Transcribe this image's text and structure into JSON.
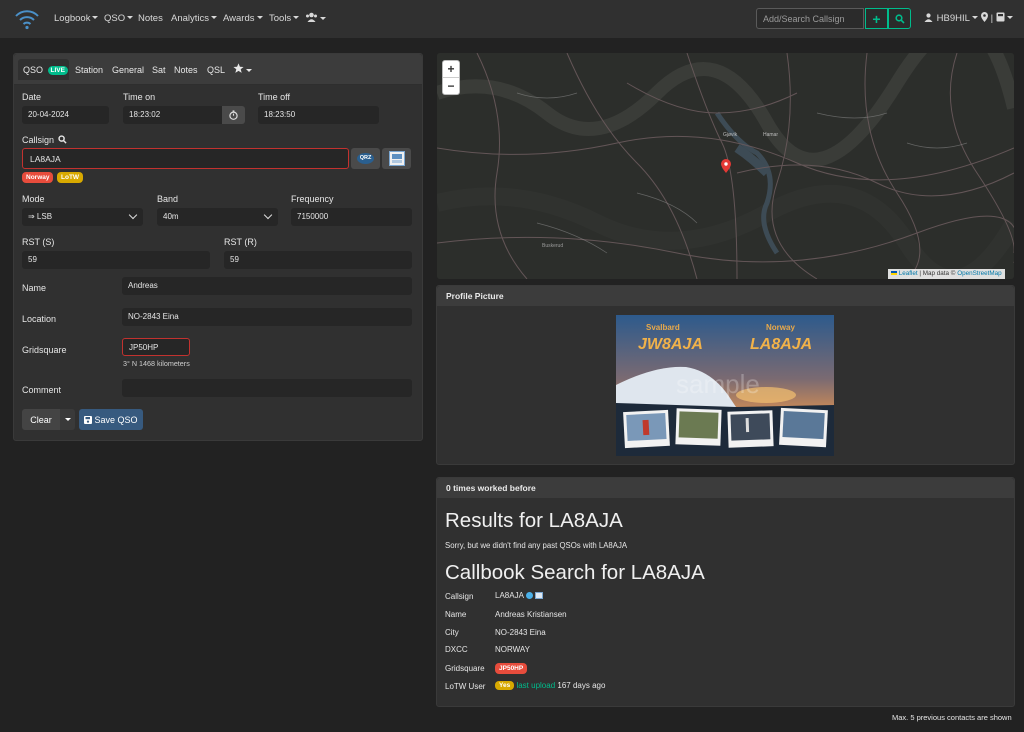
{
  "nav": {
    "items": [
      "Logbook",
      "QSO",
      "Notes",
      "Analytics",
      "Awards",
      "Tools"
    ],
    "search_placeholder": "Add/Search Callsign",
    "user": "HB9HIL"
  },
  "qso": {
    "tabs": {
      "qso": "QSO",
      "live": "LIVE",
      "station": "Station",
      "general": "General",
      "sat": "Sat",
      "notes": "Notes",
      "qsl": "QSL"
    },
    "date_label": "Date",
    "date": "20-04-2024",
    "time_on_label": "Time on",
    "time_on": "18:23:02",
    "time_off_label": "Time off",
    "time_off": "18:23:50",
    "callsign_label": "Callsign",
    "callsign": "LA8AJA",
    "badges": {
      "country": "Norway",
      "lotw": "LoTW"
    },
    "qrz_label": "QRZ",
    "mode_label": "Mode",
    "mode": "⇒ LSB",
    "band_label": "Band",
    "band": "40m",
    "frequency_label": "Frequency",
    "frequency": "7150000",
    "rst_s_label": "RST (S)",
    "rst_s": "59",
    "rst_r_label": "RST (R)",
    "rst_r": "59",
    "name_label": "Name",
    "name": "Andreas",
    "location_label": "Location",
    "location": "NO-2843 Eina",
    "gridsquare_label": "Gridsquare",
    "gridsquare": "JP50HP",
    "bearing": "3° N 1468 kilometers",
    "comment_label": "Comment",
    "comment": "",
    "clear_button": "Clear",
    "save_button": "Save QSO"
  },
  "map": {
    "zoom_in": "+",
    "zoom_out": "−",
    "attribution_leaflet": "Leaflet",
    "attribution_text": "| Map data ©",
    "attribution_osm": "OpenStreetMap",
    "place_labels": [
      "Gjøvik",
      "Hamar",
      "Buskerud"
    ]
  },
  "profile": {
    "title": "Profile Picture",
    "image_text": {
      "left_top": "Svalbard",
      "left_call": "JW8AJA",
      "right_top": "Norway",
      "right_call": "LA8AJA",
      "watermark": "sample"
    }
  },
  "worked": {
    "title": "0 times worked before",
    "results_heading": "Results for LA8AJA",
    "results_text": "Sorry, but we didn't find any past QSOs with LA8AJA",
    "callbook_heading": "Callbook Search for LA8AJA",
    "rows": [
      {
        "label": "Callsign",
        "value": "LA8AJA"
      },
      {
        "label": "Name",
        "value": "Andreas Kristiansen"
      },
      {
        "label": "City",
        "value": "NO-2843 Eina"
      },
      {
        "label": "DXCC",
        "value": "NORWAY"
      },
      {
        "label": "Gridsquare",
        "value": "JP50HP"
      },
      {
        "label": "LoTW User",
        "value": ""
      }
    ],
    "lotw_yes": "Yes",
    "last_upload": "last upload",
    "days_ago": "167 days ago"
  },
  "footer_note": "Max. 5 previous contacts are shown",
  "colors": {
    "accent": "#00bc8c",
    "primary": "#375a7f",
    "danger": "#e74c3c",
    "warning": "#f39c12"
  }
}
